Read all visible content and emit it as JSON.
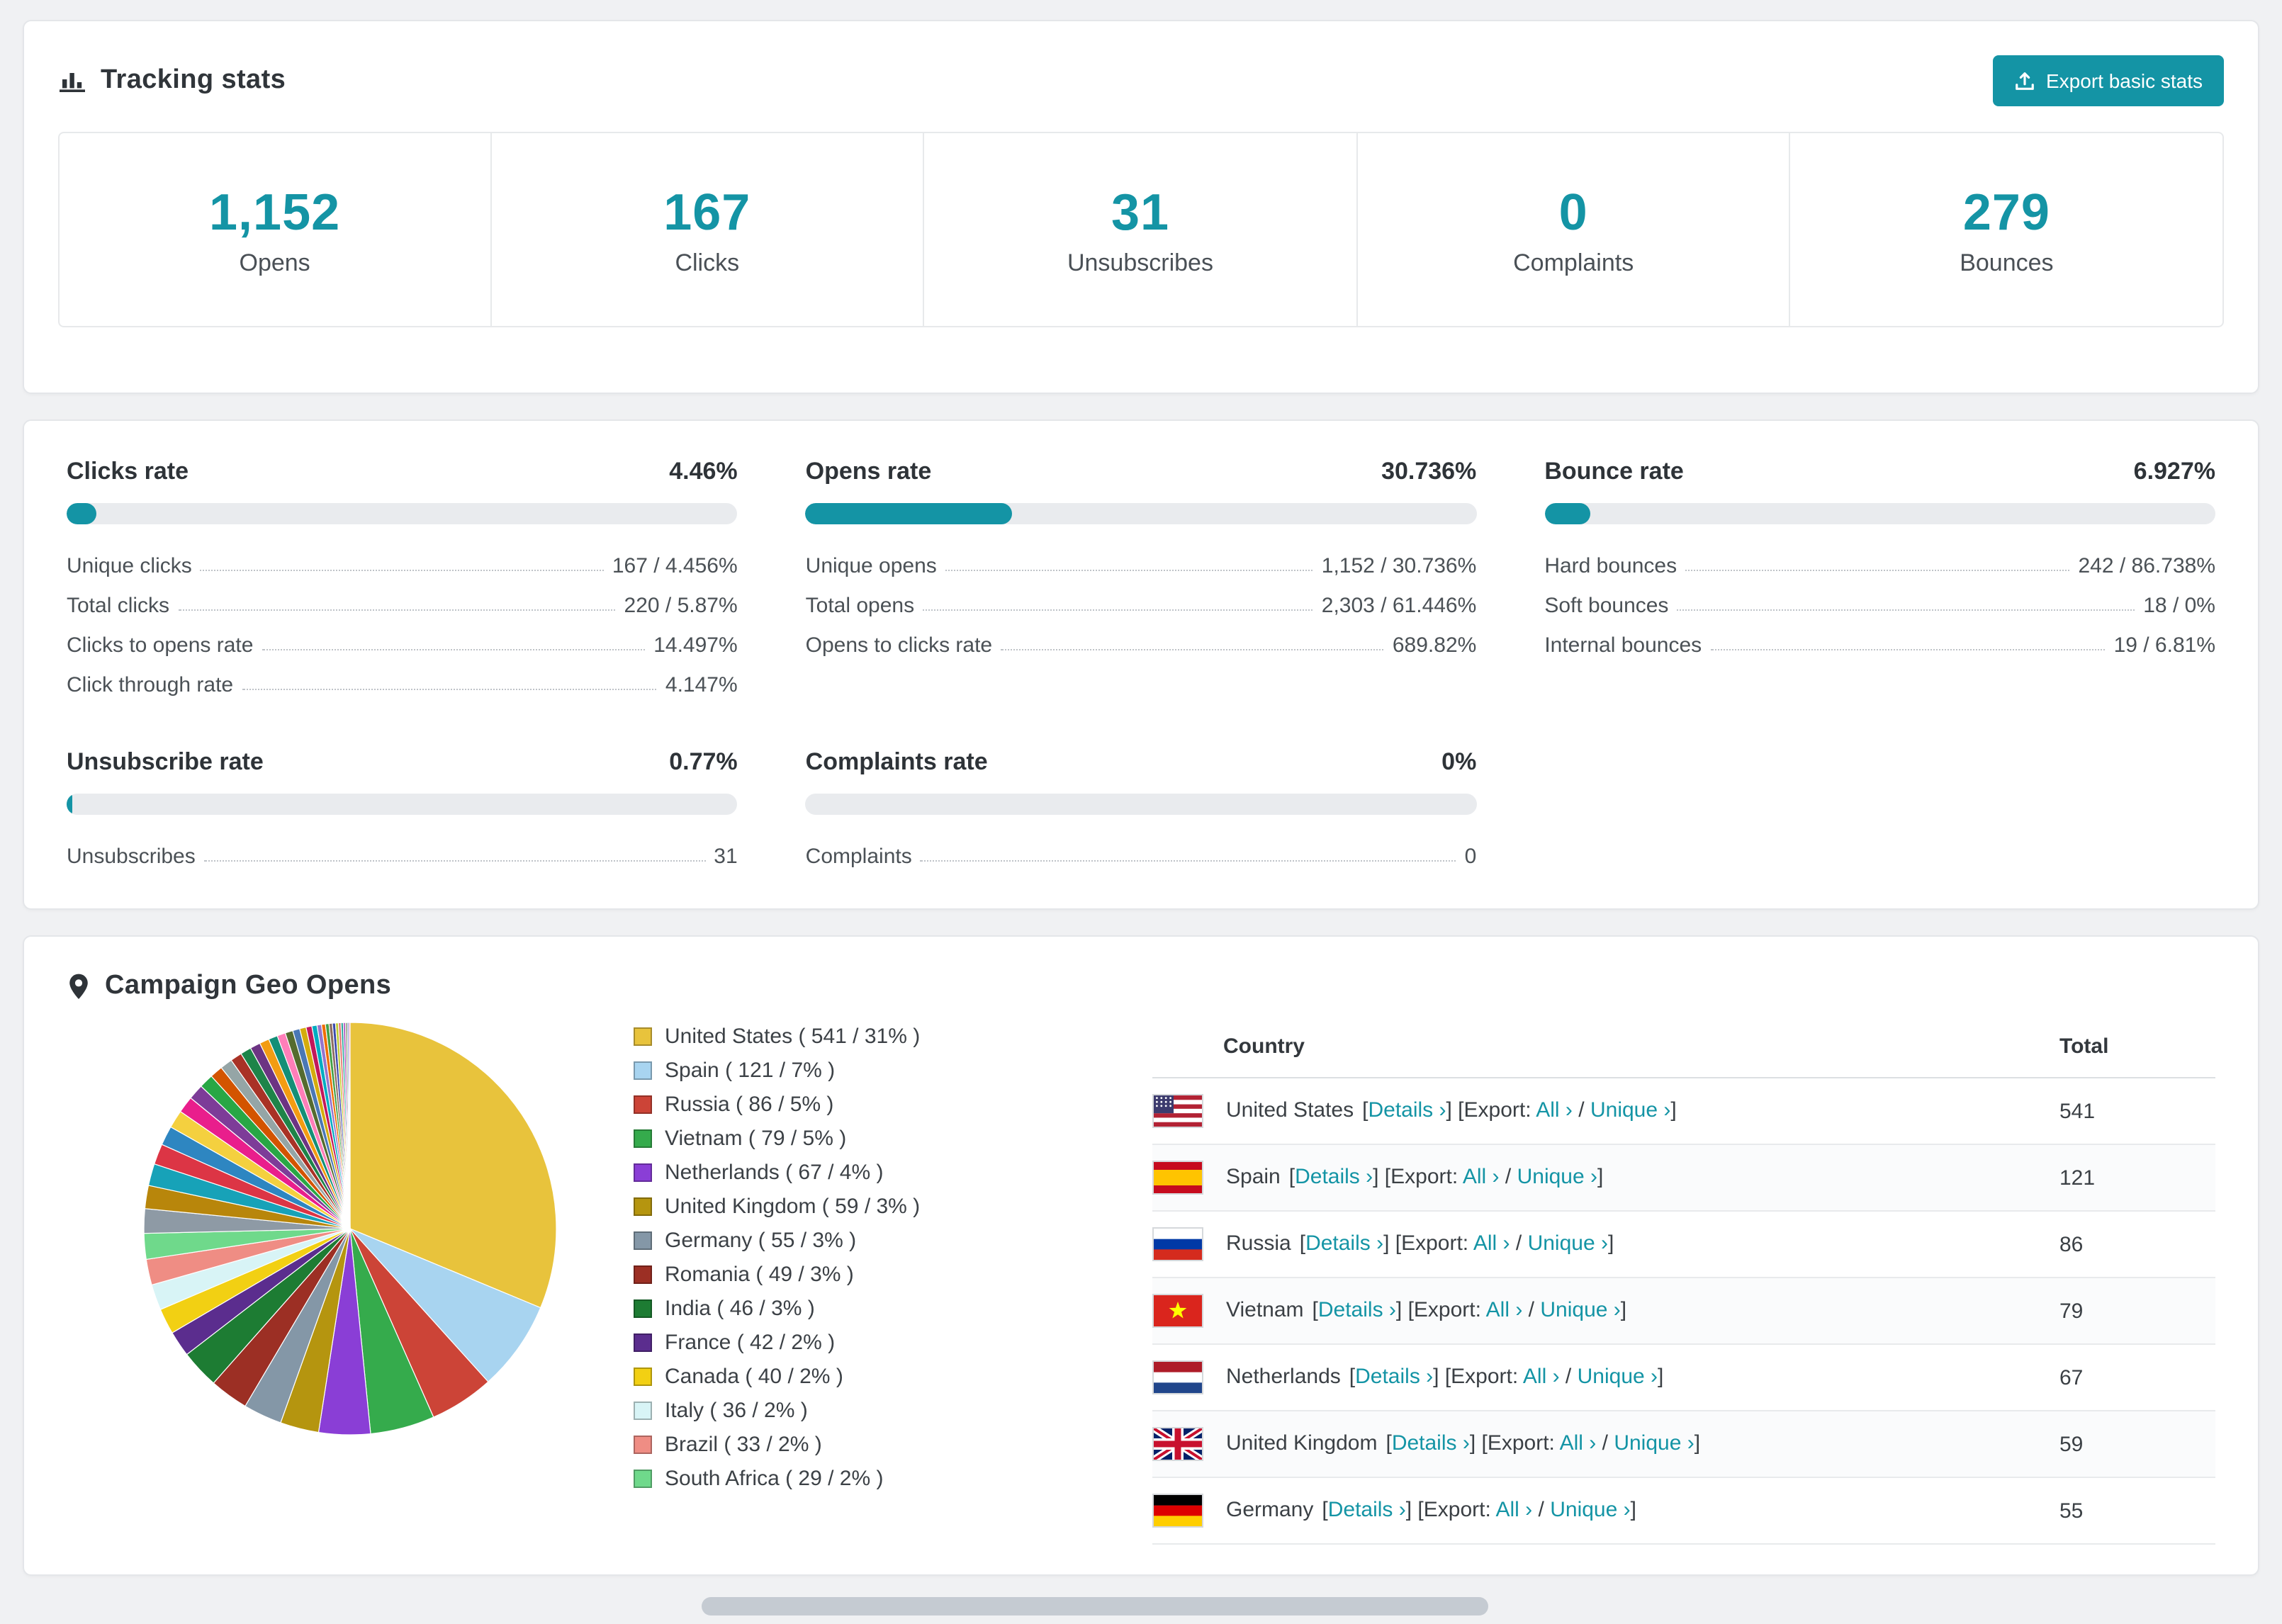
{
  "page": {
    "background": "#f0f1f3",
    "accent": "#1494a5"
  },
  "tracking": {
    "title": "Tracking stats",
    "export_button_label": "Export basic stats",
    "stats": [
      {
        "value": "1,152",
        "label": "Opens"
      },
      {
        "value": "167",
        "label": "Clicks"
      },
      {
        "value": "31",
        "label": "Unsubscribes"
      },
      {
        "value": "0",
        "label": "Complaints"
      },
      {
        "value": "279",
        "label": "Bounces"
      }
    ]
  },
  "rates": {
    "panels": [
      {
        "title": "Clicks rate",
        "value": "4.46%",
        "percent": 4.46,
        "items": [
          {
            "label": "Unique clicks",
            "value": "167 / 4.456%"
          },
          {
            "label": "Total clicks",
            "value": "220 / 5.87%"
          },
          {
            "label": "Clicks to opens rate",
            "value": "14.497%"
          },
          {
            "label": "Click through rate",
            "value": "4.147%"
          }
        ]
      },
      {
        "title": "Opens rate",
        "value": "30.736%",
        "percent": 30.736,
        "items": [
          {
            "label": "Unique opens",
            "value": "1,152 / 30.736%"
          },
          {
            "label": "Total opens",
            "value": "2,303 / 61.446%"
          },
          {
            "label": "Opens to clicks rate",
            "value": "689.82%"
          }
        ]
      },
      {
        "title": "Bounce rate",
        "value": "6.927%",
        "percent": 6.927,
        "items": [
          {
            "label": "Hard bounces",
            "value": "242 / 86.738%"
          },
          {
            "label": "Soft bounces",
            "value": "18 / 0%"
          },
          {
            "label": "Internal bounces",
            "value": "19 / 6.81%"
          }
        ]
      },
      {
        "title": "Unsubscribe rate",
        "value": "0.77%",
        "percent": 0.77,
        "items": [
          {
            "label": "Unsubscribes",
            "value": "31"
          }
        ]
      },
      {
        "title": "Complaints rate",
        "value": "0%",
        "percent": 0,
        "items": [
          {
            "label": "Complaints",
            "value": "0"
          }
        ]
      }
    ]
  },
  "geo": {
    "title": "Campaign Geo Opens",
    "table": {
      "headers": [
        "Country",
        "Total"
      ],
      "labels": {
        "details": "Details ›",
        "export": "Export:",
        "all": "All ›",
        "unique": "Unique ›"
      },
      "rows": [
        {
          "country": "United States",
          "flag": "us",
          "total": "541"
        },
        {
          "country": "Spain",
          "flag": "es",
          "total": "121"
        },
        {
          "country": "Russia",
          "flag": "ru",
          "total": "86"
        },
        {
          "country": "Vietnam",
          "flag": "vn",
          "total": "79"
        },
        {
          "country": "Netherlands",
          "flag": "nl",
          "total": "67"
        },
        {
          "country": "United Kingdom",
          "flag": "gb",
          "total": "59"
        },
        {
          "country": "Germany",
          "flag": "de",
          "total": "55"
        }
      ]
    }
  },
  "chart_data": {
    "type": "pie",
    "title": "Campaign Geo Opens",
    "legend_position": "right",
    "slices": [
      {
        "name": "United States",
        "count": 541,
        "percent": 31,
        "color": "#e8c33c"
      },
      {
        "name": "Spain",
        "count": 121,
        "percent": 7,
        "color": "#a8d4f0"
      },
      {
        "name": "Russia",
        "count": 86,
        "percent": 5,
        "color": "#cc4437"
      },
      {
        "name": "Vietnam",
        "count": 79,
        "percent": 5,
        "color": "#35ab4c"
      },
      {
        "name": "Netherlands",
        "count": 67,
        "percent": 4,
        "color": "#8a3ed6"
      },
      {
        "name": "United Kingdom",
        "count": 59,
        "percent": 3,
        "color": "#b5950f"
      },
      {
        "name": "Germany",
        "count": 55,
        "percent": 3,
        "color": "#8497a7"
      },
      {
        "name": "Romania",
        "count": 49,
        "percent": 3,
        "color": "#9c2f24"
      },
      {
        "name": "India",
        "count": 46,
        "percent": 3,
        "color": "#1d7c33"
      },
      {
        "name": "France",
        "count": 42,
        "percent": 2,
        "color": "#5b2d8e"
      },
      {
        "name": "Canada",
        "count": 40,
        "percent": 2,
        "color": "#f2d013"
      },
      {
        "name": "Italy",
        "count": 36,
        "percent": 2,
        "color": "#d8f4f6"
      },
      {
        "name": "Brazil",
        "count": 33,
        "percent": 2,
        "color": "#ef8d84"
      },
      {
        "name": "South Africa",
        "count": 29,
        "percent": 2,
        "color": "#6fd98b"
      }
    ],
    "other_slices": {
      "values": [
        1.9,
        1.8,
        1.7,
        1.6,
        1.5,
        1.4,
        1.3,
        1.2,
        1.1,
        1.0,
        0.95,
        0.9,
        0.85,
        0.8,
        0.75,
        0.7,
        0.65,
        0.6,
        0.55,
        0.5,
        0.45,
        0.4,
        0.35,
        0.3,
        0.28,
        0.26,
        0.24,
        0.22,
        0.2,
        0.18,
        0.16,
        0.14,
        0.12,
        0.1
      ],
      "colors": [
        "#8e9aa5",
        "#b8860b",
        "#17a2b8",
        "#dc3545",
        "#2e86c1",
        "#f4d03f",
        "#e91e8c",
        "#7d3c98",
        "#28a745",
        "#d35400",
        "#95a5a6",
        "#a93226",
        "#1e8449",
        "#6c3483",
        "#f39c12",
        "#148f77",
        "#ff7eb9",
        "#556b2f",
        "#4a78b5",
        "#d4ac0d",
        "#c2185b",
        "#00acc1",
        "#9575cd",
        "#ef6c00",
        "#43a047",
        "#8d6e63",
        "#3949ab",
        "#c0ca33",
        "#e57373",
        "#26a69a",
        "#ab47bc",
        "#789262",
        "#5c6bc0",
        "#f06292"
      ]
    }
  }
}
